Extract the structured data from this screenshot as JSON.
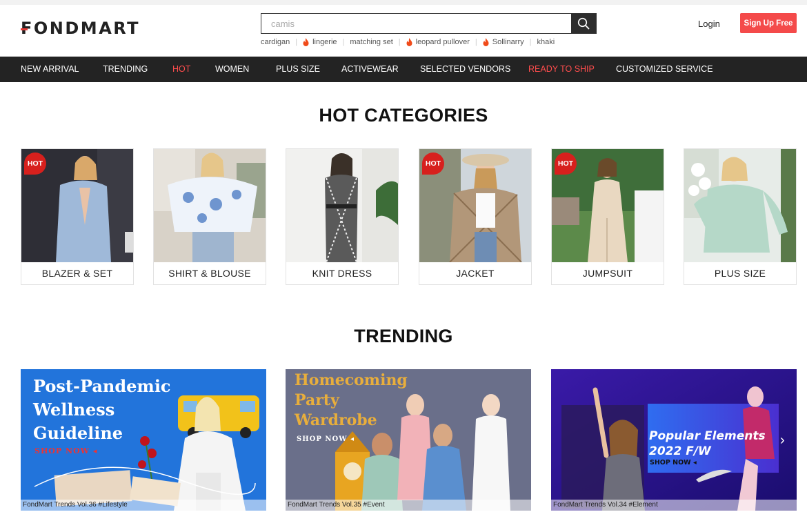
{
  "brand": {
    "logo_text": "FONDMART"
  },
  "search": {
    "placeholder": "camis"
  },
  "hot_words": [
    {
      "label": "cardigan",
      "hot": false
    },
    {
      "label": "lingerie",
      "hot": true
    },
    {
      "label": "matching set",
      "hot": false
    },
    {
      "label": "leopard pullover",
      "hot": true
    },
    {
      "label": "Sollinarry",
      "hot": true
    },
    {
      "label": "khaki",
      "hot": false
    }
  ],
  "account": {
    "login_label": "Login",
    "signup_label": "Sign Up Free"
  },
  "nav": [
    {
      "label": "NEW ARRIVAL",
      "highlight": false
    },
    {
      "label": "TRENDING",
      "highlight": false
    },
    {
      "label": "HOT",
      "highlight": true
    },
    {
      "label": "WOMEN",
      "highlight": false
    },
    {
      "label": "PLUS SIZE",
      "highlight": false
    },
    {
      "label": "ACTIVEWEAR",
      "highlight": false
    },
    {
      "label": "SELECTED VENDORS",
      "highlight": false
    },
    {
      "label": "READY TO SHIP",
      "highlight": true
    },
    {
      "label": "CUSTOMIZED SERVICE",
      "highlight": false
    }
  ],
  "hot_categories": {
    "title": "HOT CATEGORIES",
    "badge_text": "HOT",
    "items": [
      {
        "label": "BLAZER & SET",
        "hot": true
      },
      {
        "label": "SHIRT & BLOUSE",
        "hot": false
      },
      {
        "label": "KNIT DRESS",
        "hot": false
      },
      {
        "label": "JACKET",
        "hot": true
      },
      {
        "label": "JUMPSUIT",
        "hot": true
      },
      {
        "label": "PLUS SIZE",
        "hot": false
      }
    ]
  },
  "trending": {
    "title": "TRENDING",
    "banners": [
      {
        "title_lines": [
          "Post-Pandemic",
          "Wellness",
          "Guideline"
        ],
        "cta": "SHOP NOW",
        "caption": "FondMart Trends Vol.36 #Lifestyle"
      },
      {
        "title_lines": [
          "Homecoming",
          "Party",
          "Wardrobe"
        ],
        "cta": "SHOP NOW",
        "caption": "FondMart Trends Vol.35 #Event"
      },
      {
        "title_lines": [
          "Popular Elements",
          "2022 F/W"
        ],
        "cta": "SHOP NOW",
        "caption": "FondMart Trends Vol.34 #Element"
      }
    ]
  },
  "colors": {
    "accent_red": "#f44a4a",
    "nav_bg": "#232323",
    "hot_badge": "#d7201d"
  }
}
